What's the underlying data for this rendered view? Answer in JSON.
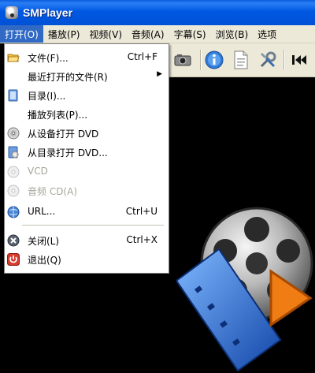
{
  "window": {
    "title": "SMPlayer"
  },
  "menubar": {
    "items": [
      {
        "label": "打开(O)"
      },
      {
        "label": "播放(P)"
      },
      {
        "label": "视频(V)"
      },
      {
        "label": "音频(A)"
      },
      {
        "label": "字幕(S)"
      },
      {
        "label": "浏览(B)"
      },
      {
        "label": "选项"
      }
    ]
  },
  "open_menu": {
    "items": [
      {
        "label": "文件(F)...",
        "shortcut": "Ctrl+F",
        "icon": "folder-open-icon"
      },
      {
        "label": "最近打开的文件(R)",
        "submenu": "▶"
      },
      {
        "label": "目录(I)...",
        "icon": "directory-icon"
      },
      {
        "label": "播放列表(P)..."
      },
      {
        "label": "从设备打开 DVD",
        "icon": "dvd-disc-icon"
      },
      {
        "label": "从目录打开 DVD...",
        "icon": "dvd-folder-icon"
      },
      {
        "label": "VCD",
        "disabled": true,
        "icon": "vcd-disc-icon"
      },
      {
        "label": "音频 CD(A)",
        "disabled": true,
        "icon": "audio-cd-icon"
      },
      {
        "label": "URL...",
        "shortcut": "Ctrl+U",
        "icon": "url-globe-icon"
      },
      {
        "label": "关闭(L)",
        "shortcut": "Ctrl+X",
        "icon": "close-circle-icon"
      },
      {
        "label": "退出(Q)",
        "icon": "power-icon"
      }
    ]
  },
  "colors": {
    "titlebar": "#0058e2",
    "menu_highlight": "#316ac5",
    "menubar_bg": "#ece9d8",
    "disabled_text": "#a7a69c",
    "video_bg": "#000000"
  }
}
